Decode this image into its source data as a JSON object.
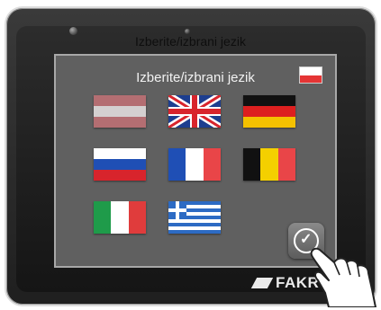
{
  "screen": {
    "title": "Izberite/izbrani jezik",
    "ghost_title": "Izberite/izbrani jezik"
  },
  "flags": [
    {
      "name": "flag-austria",
      "colors": [
        "#b46e72",
        "#d4d0d0",
        "#b46e72"
      ]
    },
    {
      "name": "flag-united-kingdom",
      "colors": [
        "#1d3e8f",
        "#ffffff",
        "#d8242c"
      ]
    },
    {
      "name": "flag-germany",
      "colors": [
        "#111111",
        "#dd1f1f",
        "#f4c100"
      ]
    },
    {
      "name": "flag-russia",
      "colors": [
        "#ffffff",
        "#1f4fb5",
        "#d8242c"
      ]
    },
    {
      "name": "flag-france",
      "colors": [
        "#1f4fb5",
        "#ffffff",
        "#e94548"
      ]
    },
    {
      "name": "flag-belgium",
      "colors": [
        "#111111",
        "#f4d000",
        "#e94548"
      ]
    },
    {
      "name": "flag-italy",
      "colors": [
        "#1f9b4a",
        "#ffffff",
        "#e03c3c"
      ]
    },
    {
      "name": "flag-greece",
      "colors": [
        "#2d6bc4",
        "#ffffff"
      ]
    }
  ],
  "selected_flag": {
    "colors": [
      "#ffffff",
      "#e53535"
    ]
  },
  "ok_button": {
    "icon": "check-icon"
  },
  "brand": {
    "name": "FAKRO"
  },
  "colors": {
    "screen_bg": "#606060",
    "device": "#222222"
  }
}
